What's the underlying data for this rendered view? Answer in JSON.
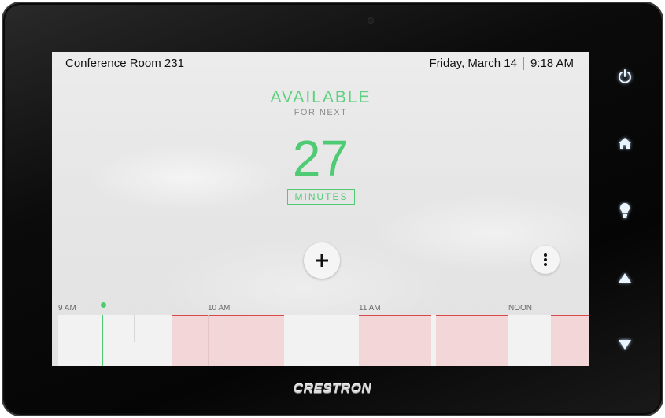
{
  "header": {
    "room_name": "Conference Room 231",
    "date": "Friday, March 14",
    "time": "9:18 AM"
  },
  "status": {
    "label": "AVAILABLE",
    "subtitle": "FOR NEXT",
    "count": "27",
    "unit": "MINUTES"
  },
  "timeline": {
    "hours": [
      "9 AM",
      "10 AM",
      "11 AM",
      "NOON"
    ]
  },
  "brand": {
    "logo": "CRESTRON"
  },
  "colors": {
    "available": "#4fcb74",
    "booked": "#f3d6d8",
    "booked_edge": "#d84a4a"
  }
}
